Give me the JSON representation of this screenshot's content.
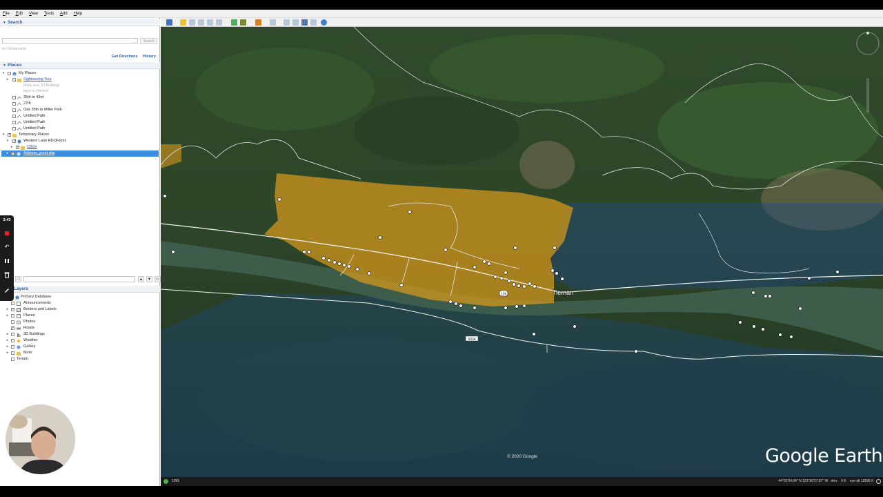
{
  "menu": [
    "File",
    "Edit",
    "View",
    "Tools",
    "Add",
    "Help"
  ],
  "search": {
    "header": "Search",
    "placeholder": "",
    "button": "Search",
    "hint": "ex: Restaurants",
    "get_directions": "Get Directions",
    "history": "History"
  },
  "places": {
    "header": "Places",
    "items": [
      {
        "label": "My Places"
      },
      {
        "label": "Sightseeing Tour"
      },
      {
        "label": "Make sure 3D Buildings"
      },
      {
        "label": "layer is checked"
      },
      {
        "label": "35th to 43rd"
      },
      {
        "label": "27th"
      },
      {
        "label": "Oak 35th to Miller Park"
      },
      {
        "label": "Untitled Path"
      },
      {
        "label": "Untitled Path"
      },
      {
        "label": "Untitled Path"
      },
      {
        "label": "Temporary Places"
      },
      {
        "label": "Western Lane RDOF.kmz"
      },
      {
        "label": "CBGs"
      },
      {
        "label": "Address_point.shp"
      }
    ]
  },
  "layers": {
    "header": "Layers",
    "items": [
      {
        "label": "Primary Database"
      },
      {
        "label": "Announcements"
      },
      {
        "label": "Borders and Labels"
      },
      {
        "label": "Places"
      },
      {
        "label": "Photos"
      },
      {
        "label": "Roads"
      },
      {
        "label": "3D Buildings"
      },
      {
        "label": "Weather"
      },
      {
        "label": "Gallery"
      },
      {
        "label": "More"
      },
      {
        "label": "Terrain"
      }
    ]
  },
  "recorder": {
    "time": "3:43"
  },
  "map": {
    "town_label": "Tiernan",
    "highway_shield": "126",
    "road_shield": "5034",
    "copyright": "© 2020 Google",
    "logo": "Google Earth"
  },
  "status": {
    "year": "1995",
    "coords": "44°01'04.04\" N  123°56'27.87\" W",
    "elev_label": "elev",
    "elev_value": "0 ft",
    "eye_alt": "eye alt  10595 ft"
  },
  "colors": {
    "polygon_gold": "#d89a1c",
    "polygon_blue": "#1e4a8a",
    "river": "#3f5f4e",
    "selection": "#3b8ee2",
    "link": "#2a5ea8"
  }
}
